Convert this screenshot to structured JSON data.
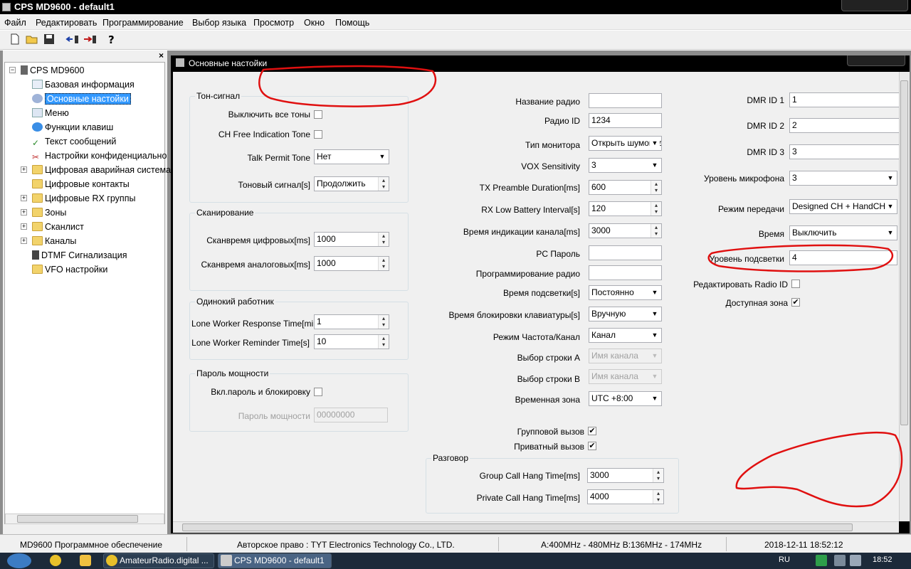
{
  "window": {
    "title": "CPS MD9600 - default1"
  },
  "menu": [
    "Файл",
    "Редактировать",
    "Программирование",
    "Выбор языка",
    "Просмотр",
    "Окно",
    "Помощь"
  ],
  "toolbar": {
    "close_pane": "×"
  },
  "tree": {
    "root": "CPS MD9600",
    "items": [
      {
        "label": "Базовая информация",
        "icon": "document-icon"
      },
      {
        "label": "Основные настойки",
        "icon": "gear-icon",
        "selected": true
      },
      {
        "label": "Меню",
        "icon": "menu-edit-icon"
      },
      {
        "label": "Функции клавиш",
        "icon": "globe-icon"
      },
      {
        "label": "Текст сообщений",
        "icon": "check-pen-icon"
      },
      {
        "label": "Настройки конфиденциально",
        "icon": "tools-icon"
      },
      {
        "label": "Цифровая аварийная система",
        "icon": "folder-icon",
        "expandable": true
      },
      {
        "label": "Цифровые контакты",
        "icon": "folder-icon"
      },
      {
        "label": "Цифровые RX группы",
        "icon": "folder-icon",
        "expandable": true
      },
      {
        "label": "Зоны",
        "icon": "folder-icon",
        "expandable": true
      },
      {
        "label": "Сканлист",
        "icon": "folder-icon",
        "expandable": true
      },
      {
        "label": "Каналы",
        "icon": "folder-icon",
        "expandable": true
      },
      {
        "label": "DTMF Сигнализация",
        "icon": "dtmf-icon"
      },
      {
        "label": "VFO настройки",
        "icon": "folder-icon"
      }
    ]
  },
  "child": {
    "title": "Основные настойки"
  },
  "tone": {
    "title": "Тон-сигнал",
    "disable_all_label": "Выключить все тоны",
    "ch_free_label": "CH Free Indication Tone",
    "talk_permit_label": "Talk Permit Tone",
    "talk_permit_value": "Нет",
    "tone_signal_label": "Тоновый сигнал[s]",
    "tone_signal_value": "Продолжить"
  },
  "scan": {
    "title": "Сканирование",
    "digital_label": "Сканвремя цифровых[ms]",
    "digital_value": "1000",
    "analog_label": "Сканвремя аналоговых[ms]",
    "analog_value": "1000"
  },
  "lone": {
    "title": "Одинокий работник",
    "response_label": "Lone Worker Response Time[min]",
    "response_value": "1",
    "reminder_label": "Lone Worker Reminder Time[s]",
    "reminder_value": "10"
  },
  "pwr": {
    "title": "Пароль мощности",
    "lock_label": "Вкл.пароль и блокировку",
    "password_label": "Пароль мощности",
    "password_value": "00000000"
  },
  "mid": {
    "radio_name_label": "Название радио",
    "radio_name_value": "",
    "radio_id_label": "Радио ID",
    "radio_id_value": "1234",
    "monitor_label": "Тип монитора",
    "monitor_value": "Открыть шумоподавитель",
    "vox_label": "VOX Sensitivity",
    "vox_value": "3",
    "tx_preamble_label": "TX Preamble Duration[ms]",
    "tx_preamble_value": "600",
    "rx_low_label": "RX Low Battery Interval[s]",
    "rx_low_value": "120",
    "ch_indic_label": "Время индикации канала[ms]",
    "ch_indic_value": "3000",
    "pc_pass_label": "PC Пароль",
    "pc_pass_value": "",
    "prog_label": "Программирование радио",
    "prog_value": "",
    "backlight_label": "Время подсветки[s]",
    "backlight_value": "Постоянно",
    "keylock_label": "Время блокировки клавиатуры[s]",
    "keylock_value": "Вручную",
    "freq_ch_label": "Режим Частота/Канал",
    "freq_ch_value": "Канал",
    "row_a_label": "Выбор строки A",
    "row_a_value": "Имя канала",
    "row_b_label": "Выбор строки B",
    "row_b_value": "Имя канала",
    "tz_label": "Временная зона",
    "tz_value": "UTC +8:00",
    "group_call_label": "Групповой вызов",
    "private_call_label": "Приватный вызов"
  },
  "talk": {
    "title": "Разговор",
    "group_hang_label": "Group Call Hang Time[ms]",
    "group_hang_value": "3000",
    "private_hang_label": "Private Call Hang Time[ms]",
    "private_hang_value": "4000"
  },
  "right": {
    "dmr1_label": "DMR ID 1",
    "dmr1_value": "1",
    "dmr2_label": "DMR ID 2",
    "dmr2_value": "2",
    "dmr3_label": "DMR ID 3",
    "dmr3_value": "3",
    "mic_label": "Уровень микрофона",
    "mic_value": "3",
    "tx_mode_label": "Режим передачи",
    "tx_mode_value": "Designed CH + HandCH",
    "time_label": "Время",
    "time_value": "Выключить",
    "backlight_level_label": "Уровень подсветки",
    "backlight_level_value": "4",
    "edit_radio_id_label": "Редактировать Radio ID",
    "zone_label": "Доступная зона"
  },
  "status": {
    "left": "MD9600 Программное обеспечение",
    "copyright": "Авторское право : TYT Electronics Technology Co., LTD.",
    "freq": "A:400MHz - 480MHz B:136MHz - 174MHz",
    "datetime": "2018-12-11 18:52:12"
  },
  "taskbar": {
    "task1": "AmateurRadio.digital ...",
    "task2": "CPS MD9600 - default1",
    "lang": "RU",
    "clock": "18:52"
  },
  "colors": {
    "annotation": "#e01010",
    "selection": "#3399ff"
  }
}
